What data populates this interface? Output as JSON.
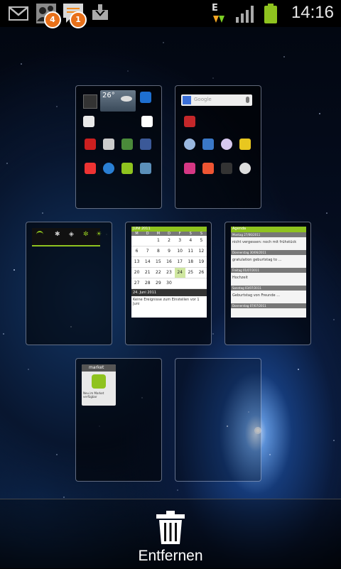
{
  "status_bar": {
    "icons": [
      "gmail-icon",
      "people-notification-icon",
      "messages-notification-icon",
      "download-icon",
      "data-e-icon",
      "signal-icon",
      "battery-icon"
    ],
    "notification_counts": {
      "people": "4",
      "messages": "1"
    },
    "network_type": "E",
    "time": "14:16"
  },
  "remove_bar": {
    "label": "Entfernen"
  },
  "panels": {
    "p1": {
      "weather_temp": "26°",
      "apps": [
        "Kalender",
        "YouTube",
        "Kamera",
        "Galerie",
        "Facebook",
        "Gmail",
        "Browser",
        "Market",
        "Musik",
        "Dropbox",
        "Kontakte"
      ]
    },
    "p2": {
      "search_placeholder": "Google",
      "apps": [
        "Aufgaben",
        "SMS",
        "Telefon",
        "Gallery",
        "Tips"
      ]
    },
    "p4": {
      "month_header": "JUNI 2011",
      "day_headers": [
        "M",
        "D",
        "M",
        "D",
        "F",
        "S",
        "S"
      ],
      "weeks": [
        [
          "",
          "",
          "1",
          "2",
          "3",
          "4",
          "5"
        ],
        [
          "6",
          "7",
          "8",
          "9",
          "10",
          "11",
          "12"
        ],
        [
          "13",
          "14",
          "15",
          "16",
          "17",
          "18",
          "19"
        ],
        [
          "20",
          "21",
          "22",
          "23",
          "24",
          "25",
          "26"
        ],
        [
          "27",
          "28",
          "29",
          "30",
          "",
          "",
          ""
        ]
      ],
      "date_line": "24. Juni 2011",
      "event_text": "Keine Ereignisse zum Einstellen vor 1 Juni"
    },
    "p5": {
      "header": "Agenda",
      "items": [
        {
          "date": "Montag 27/06/2011",
          "text": "nicht vergessen: noch mit frühstück"
        },
        {
          "date": "Donnerstag 30/06/2011",
          "text": "gratulation geburtstag to ..."
        },
        {
          "date": "Freitag 01/07/2011",
          "text": "Hochzeit"
        },
        {
          "date": "Sonntag 03/07/2011",
          "text": "Geburtstag von Freunde ..."
        },
        {
          "date": "Donnerstag 07/07/2011",
          "text": ""
        }
      ]
    },
    "p7": {
      "widget_title": "market",
      "widget_text": "Neu im Market verfügbar"
    }
  },
  "colors": {
    "accent_green": "#8fc31f",
    "panel_border": "#c8d6f0",
    "status_bar": "#000000"
  }
}
